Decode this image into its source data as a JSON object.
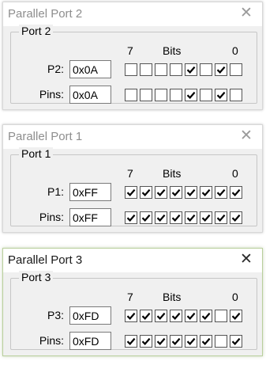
{
  "windows": [
    {
      "title": "Parallel Port 2",
      "group_label": "Port 2",
      "bits_header": {
        "high": "7",
        "caption": "Bits",
        "low": "0"
      },
      "port_label": "P2:",
      "port_value": "0x0A",
      "pins_label": "Pins:",
      "pins_value": "0x0A",
      "port_bits": [
        false,
        false,
        false,
        false,
        true,
        false,
        true,
        false
      ],
      "pins_bits": [
        false,
        false,
        false,
        false,
        true,
        false,
        true,
        false
      ],
      "active": false
    },
    {
      "title": "Parallel Port 1",
      "group_label": "Port 1",
      "bits_header": {
        "high": "7",
        "caption": "Bits",
        "low": "0"
      },
      "port_label": "P1:",
      "port_value": "0xFF",
      "pins_label": "Pins:",
      "pins_value": "0xFF",
      "port_bits": [
        true,
        true,
        true,
        true,
        true,
        true,
        true,
        true
      ],
      "pins_bits": [
        true,
        true,
        true,
        true,
        true,
        true,
        true,
        true
      ],
      "active": false
    },
    {
      "title": "Parallel Port 3",
      "group_label": "Port 3",
      "bits_header": {
        "high": "7",
        "caption": "Bits",
        "low": "0"
      },
      "port_label": "P3:",
      "port_value": "0xFD",
      "pins_label": "Pins:",
      "pins_value": "0xFD",
      "port_bits": [
        true,
        true,
        true,
        true,
        true,
        true,
        false,
        true
      ],
      "pins_bits": [
        true,
        true,
        true,
        true,
        true,
        true,
        false,
        true
      ],
      "active": true
    }
  ],
  "colors": {
    "active_border": "#b9cf9c",
    "inactive_title": "#8e8e8e",
    "window_bg": "#f0f0f0"
  },
  "icons": {
    "close": "close-icon",
    "check": "checkmark-icon"
  }
}
